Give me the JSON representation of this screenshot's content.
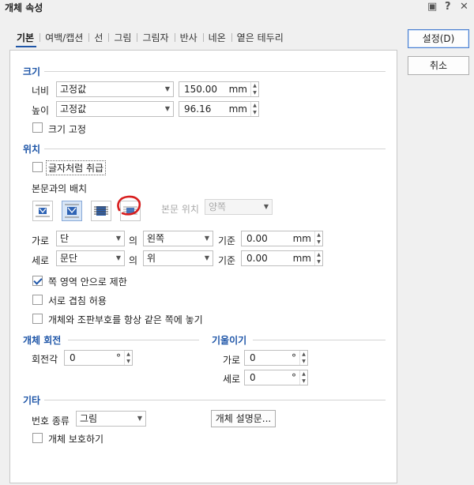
{
  "window": {
    "title": "개체 속성"
  },
  "tabs": [
    {
      "label": "기본",
      "active": true
    },
    {
      "label": "여백/캡션"
    },
    {
      "label": "선"
    },
    {
      "label": "그림"
    },
    {
      "label": "그림자"
    },
    {
      "label": "반사"
    },
    {
      "label": "네온"
    },
    {
      "label": "옅은 테두리"
    }
  ],
  "buttons": {
    "ok": "설정(D)",
    "cancel": "취소"
  },
  "size": {
    "section": "크기",
    "width_label": "너비",
    "width_mode": "고정값",
    "width_value": "150.00",
    "width_unit": "mm",
    "height_label": "높이",
    "height_mode": "고정값",
    "height_value": "96.16",
    "height_unit": "mm",
    "fix_label": "크기 고정",
    "fix_checked": false
  },
  "position": {
    "section": "위치",
    "treat_as_char_label": "글자처럼 취급",
    "treat_as_char_checked": false,
    "wrap_label": "본문과의 배치",
    "text_pos_label": "본문 위치",
    "text_pos_value": "양쪽",
    "h_label": "가로",
    "h_mode": "단",
    "h_of": "의",
    "h_align": "왼쪽",
    "h_ref": "기준",
    "h_value": "0.00",
    "h_unit": "mm",
    "v_label": "세로",
    "v_mode": "문단",
    "v_of": "의",
    "v_align": "위",
    "v_ref": "기준",
    "v_value": "0.00",
    "v_unit": "mm",
    "limit_label": "쪽 영역 안으로 제한",
    "limit_checked": true,
    "overlap_label": "서로 겹침 허용",
    "overlap_checked": false,
    "same_page_label": "개체와 조판부호를 항상 같은 쪽에 놓기",
    "same_page_checked": false
  },
  "rotate": {
    "section": "개체 회전",
    "angle_label": "회전각",
    "angle_value": "0",
    "angle_unit": "°"
  },
  "skew": {
    "section": "기울이기",
    "h_label": "가로",
    "h_value": "0",
    "v_label": "세로",
    "v_value": "0",
    "unit": "°"
  },
  "etc": {
    "section": "기타",
    "num_type_label": "번호 종류",
    "num_type_value": "그림",
    "desc_button": "개체 설명문...",
    "protect_label": "개체 보호하기",
    "protect_checked": false
  },
  "colors": {
    "section": "#1f56a8",
    "annotation": "#d81e1e",
    "selected": "#d8e6f7"
  }
}
